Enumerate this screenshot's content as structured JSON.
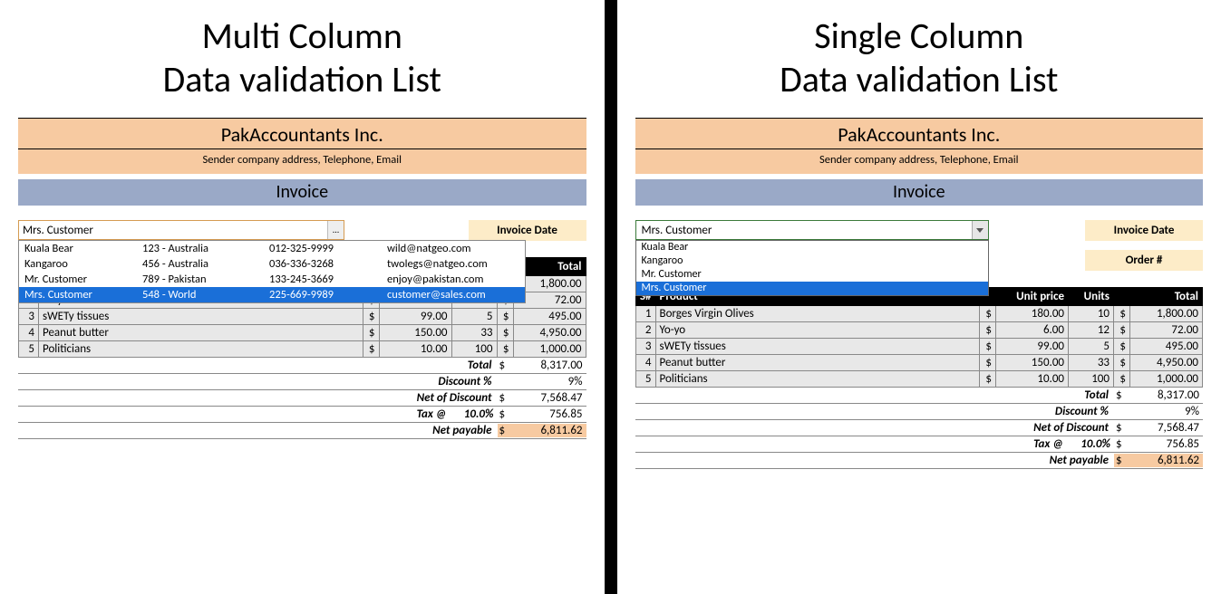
{
  "left": {
    "title_line1": "Multi Column",
    "title_line2": "Data validation List",
    "company": "PakAccountants Inc.",
    "company_sub": "Sender company address, Telephone, Email",
    "invoice_label": "Invoice",
    "combo_value": "Mrs. Customer",
    "ellipsis": "...",
    "dropdown": [
      {
        "name": "Kuala Bear",
        "addr": "123 - Australia",
        "phone": "012-325-9999",
        "email": "wild@natgeo.com",
        "selected": false
      },
      {
        "name": "Kangaroo",
        "addr": "456 - Australia",
        "phone": "036-336-3268",
        "email": "twolegs@natgeo.com",
        "selected": false
      },
      {
        "name": "Mr. Customer",
        "addr": "789 - Pakistan",
        "phone": "133-245-3669",
        "email": "enjoy@pakistan.com",
        "selected": false
      },
      {
        "name": "Mrs. Customer",
        "addr": "548 - World",
        "phone": "225-669-9989",
        "email": "customer@sales.com",
        "selected": true
      }
    ],
    "invoice_date_label": "Invoice Date"
  },
  "right": {
    "title_line1": "Single Column",
    "title_line2": "Data validation List",
    "company": "PakAccountants Inc.",
    "company_sub": "Sender company address, Telephone, Email",
    "invoice_label": "Invoice",
    "combo_value": "Mrs. Customer",
    "dropdown": [
      {
        "name": "Kuala Bear",
        "selected": false
      },
      {
        "name": "Kangaroo",
        "selected": false
      },
      {
        "name": "Mr. Customer",
        "selected": false
      },
      {
        "name": "Mrs. Customer",
        "selected": true
      }
    ],
    "invoice_date_label": "Invoice Date",
    "order_label": "Order #",
    "faded_text": "customer@sales.com"
  },
  "table": {
    "headers": {
      "sn": "S#",
      "product": "Product",
      "unit_price": "Unit price",
      "units": "Units",
      "total": "Total"
    },
    "currency": "$",
    "rows": [
      {
        "sn": "1",
        "product": "Borges Virgin Olives",
        "unit_price": "180.00",
        "units": "10",
        "total": "1,800.00"
      },
      {
        "sn": "2",
        "product": "Yo-yo",
        "unit_price": "6.00",
        "units": "12",
        "total": "72.00"
      },
      {
        "sn": "3",
        "product": "sWETy tissues",
        "unit_price": "99.00",
        "units": "5",
        "total": "495.00"
      },
      {
        "sn": "4",
        "product": "Peanut butter",
        "unit_price": "150.00",
        "units": "33",
        "total": "4,950.00"
      },
      {
        "sn": "5",
        "product": "Politicians",
        "unit_price": "10.00",
        "units": "100",
        "total": "1,000.00"
      }
    ],
    "summary": {
      "total_label": "Total",
      "total_val": "8,317.00",
      "discount_label": "Discount %",
      "discount_val": "9%",
      "net_disc_label": "Net of Discount",
      "net_disc_val": "7,568.47",
      "tax_label": "Tax @",
      "tax_pct": "10.0%",
      "tax_val": "756.85",
      "net_pay_label": "Net payable",
      "net_pay_val": "6,811.62"
    }
  }
}
